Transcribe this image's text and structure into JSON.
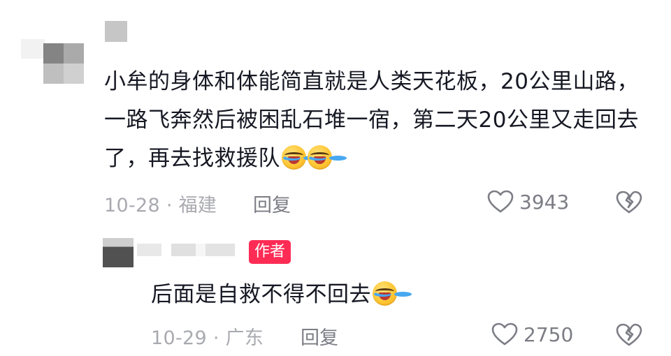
{
  "comment": {
    "text": "小牟的身体和体能简直就是人类天花板，20公里山路，一路飞奔然后被困乱石堆一宿，第二天20公里又走回去了，再去找救援队",
    "emojis": [
      "tears-of-joy-emoji",
      "tears-of-joy-emoji"
    ],
    "meta": "10-28 · 福建",
    "reply_label": "回复",
    "likes": "3943"
  },
  "reply": {
    "badge": "作者",
    "text": "后面是自救不得不回去",
    "emojis": [
      "tears-of-joy-emoji"
    ],
    "meta": "10-29 · 广东",
    "reply_label": "回复",
    "likes": "2750"
  },
  "colors": {
    "badge_bg": "#fe2c55",
    "meta": "#a9aab0",
    "action": "#7c7d85"
  }
}
